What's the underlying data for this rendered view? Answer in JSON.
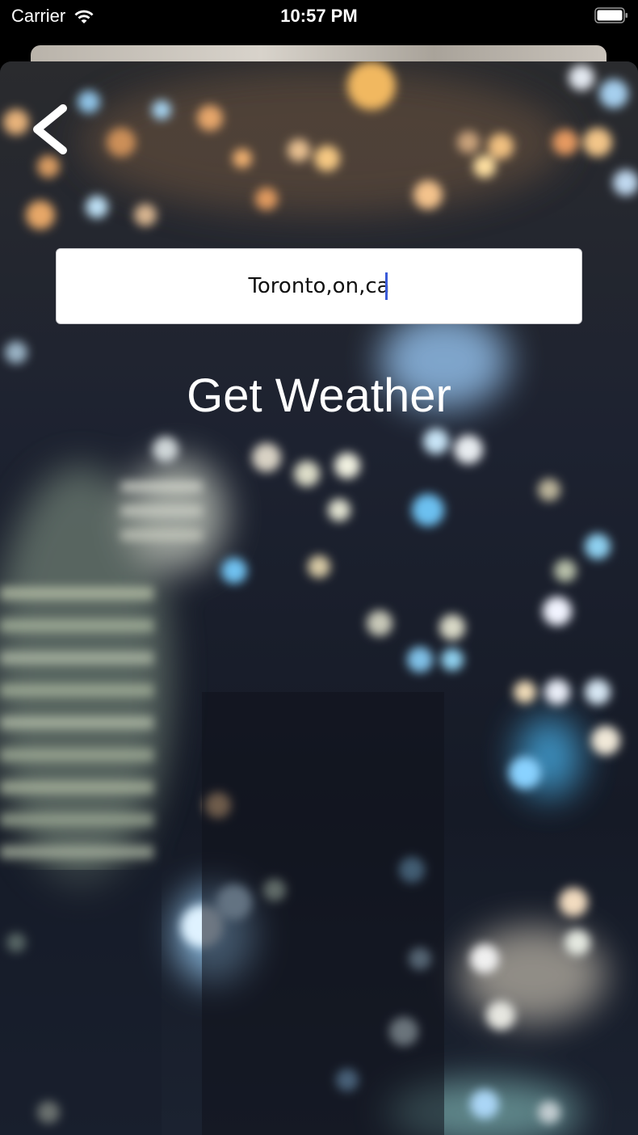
{
  "status_bar": {
    "carrier": "Carrier",
    "time": "10:57 PM",
    "wifi_icon": "wifi-icon",
    "battery_icon": "battery-icon"
  },
  "screen": {
    "back_icon": "chevron-left-icon",
    "city_input_value": "Toronto,on,ca",
    "get_weather_label": "Get Weather"
  },
  "colors": {
    "caret": "#3a5bd8",
    "button_text": "#ffffff"
  }
}
